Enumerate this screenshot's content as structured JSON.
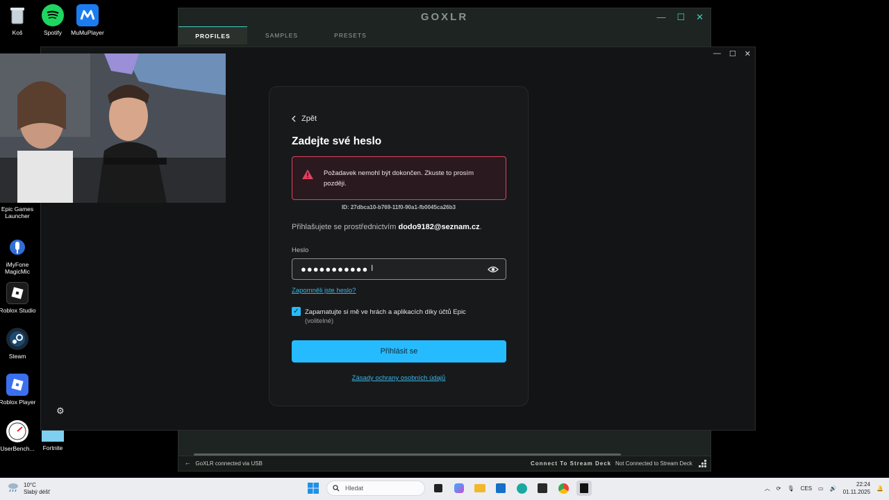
{
  "desktop": {
    "icons_top": [
      {
        "label": "Koš",
        "icon": "recycle-bin-icon"
      },
      {
        "label": "Spotify",
        "icon": "spotify-icon"
      },
      {
        "label": "MuMuPlayer",
        "icon": "mumuplayer-icon"
      }
    ],
    "icons_left": [
      {
        "label": "Epic Games Launcher",
        "icon": "epic-games-icon"
      },
      {
        "label": "iMyFone MagicMic",
        "icon": "magicmic-icon"
      },
      {
        "label": "Roblox Studio",
        "icon": "roblox-studio-icon"
      },
      {
        "label": "Steam",
        "icon": "steam-icon"
      },
      {
        "label": "Roblox Player",
        "icon": "roblox-player-icon"
      },
      {
        "label": "UserBench...",
        "icon": "userbenchmark-icon"
      },
      {
        "label": "Fortnite",
        "icon": "fortnite-icon"
      }
    ]
  },
  "goxlr": {
    "title": "GOXLR",
    "tabs": [
      "PROFILES",
      "SAMPLES",
      "PRESETS"
    ],
    "status": {
      "usb": "GoXLR connected via USB",
      "connect_stream_deck": "Connect To Stream Deck",
      "not_connected": "Not Connected to Stream Deck"
    }
  },
  "epic": {
    "back_label": "Zpět",
    "heading": "Zadejte své heslo",
    "error_message": "Požadavek nemohl být dokončen. Zkuste to prosím později.",
    "error_id": "ID: 27dbca10-b769-11f0-90a1-fb0045ca26b3",
    "signin_prefix": "Přihlašujete se prostřednictvím",
    "signin_email": "dodo9182@seznam.cz",
    "signin_suffix": ".",
    "password_label": "Heslo",
    "password_value": "●●●●●●●●●●●",
    "forgot_label": "Zapomněli jste heslo?",
    "remember_label": "Zapamatujte si mě ve hrách a aplikacích díky účtů Epic",
    "remember_optional": "(volitelné)",
    "remember_checked": true,
    "login_label": "Přihlásit se",
    "privacy_label": "Zásady ochrany osobních údajů"
  },
  "taskbar": {
    "weather_temp": "10°C",
    "weather_desc": "Slabý déšť",
    "search_placeholder": "Hledat",
    "language": "CES",
    "time": "22:24",
    "date": "01.11.2025"
  },
  "colors": {
    "accent_teal": "#3fd3c0",
    "epic_blue": "#26bbff",
    "error_red": "#e0415f"
  }
}
